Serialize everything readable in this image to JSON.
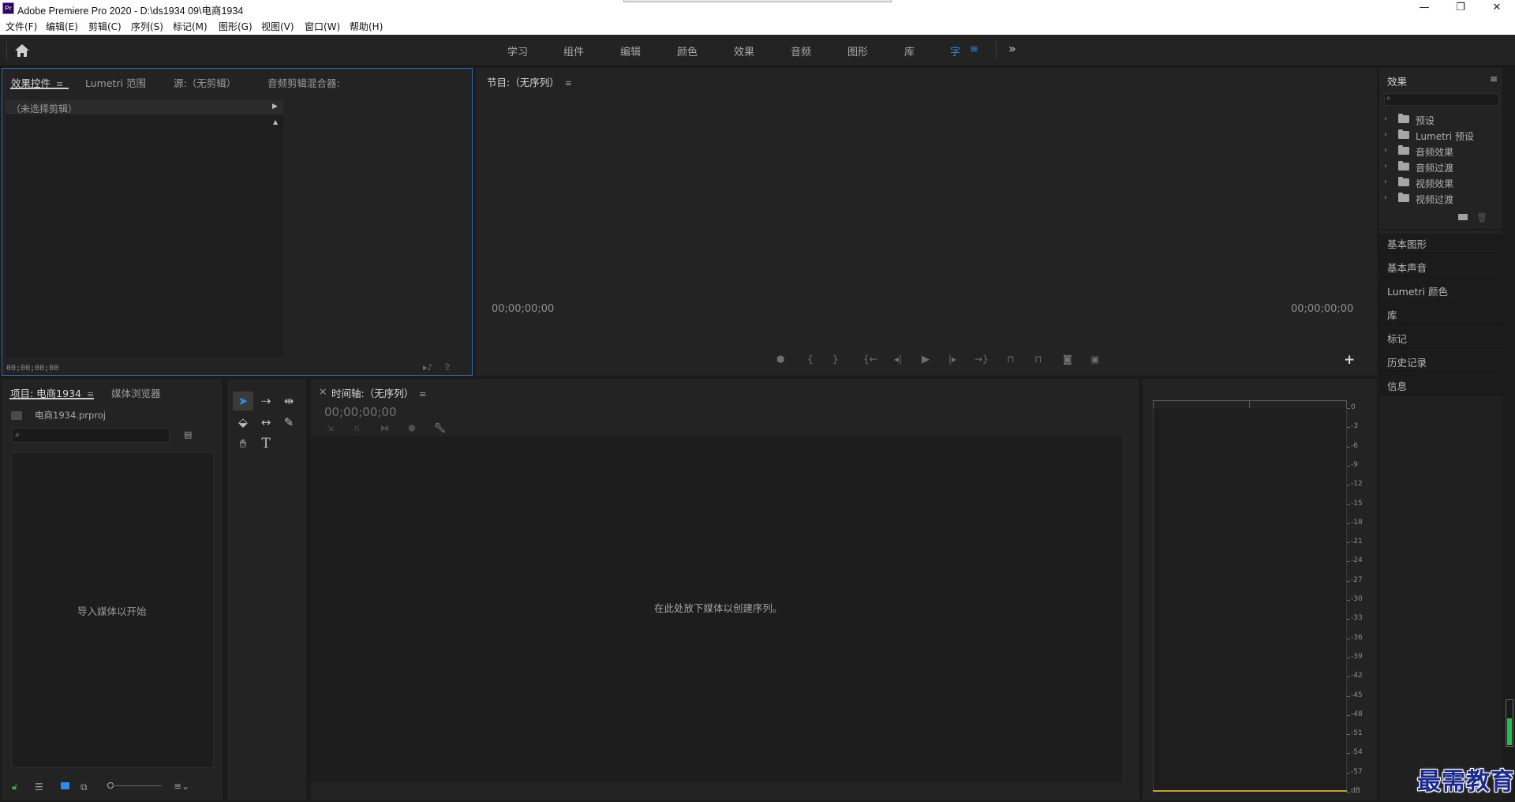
{
  "window": {
    "app_icon": "Pr",
    "title": "Adobe Premiere Pro 2020 - D:\\ds1934  09\\电商1934",
    "controls": {
      "minimize": "—",
      "restore": "❐",
      "close": "✕"
    }
  },
  "menu": {
    "items": [
      "文件(F)",
      "编辑(E)",
      "剪辑(C)",
      "序列(S)",
      "标记(M)",
      "图形(G)",
      "视图(V)",
      "窗口(W)",
      "帮助(H)"
    ]
  },
  "workspaces": {
    "tabs": [
      "学习",
      "组件",
      "编辑",
      "颜色",
      "效果",
      "音频",
      "图形",
      "库",
      "字"
    ],
    "active": "字",
    "menu_icon": "≡",
    "overflow": "»"
  },
  "source_panel": {
    "tabs": [
      "效果控件",
      "Lumetri 范围",
      "源:（无剪辑）",
      "音频剪辑混合器:"
    ],
    "menu_icon": "≡",
    "no_clip": "（未选择剪辑）",
    "timecode": "00;00;00;00"
  },
  "program_panel": {
    "title": "节目:（无序列）",
    "menu_icon": "≡",
    "timecode_left": "00;00;00;00",
    "timecode_right": "00;00;00;00",
    "add_button": "+"
  },
  "project_panel": {
    "tabs": [
      "项目: 电商1934",
      "媒体浏览器"
    ],
    "menu_icon": "≡",
    "file_name": "电商1934.prproj",
    "search_placeholder": "",
    "empty_text": "导入媒体以开始"
  },
  "timeline_panel": {
    "close": "×",
    "title": "时间轴:（无序列）",
    "menu_icon": "≡",
    "timecode": "00;00;00;00",
    "drop_text": "在此处放下媒体以创建序列。"
  },
  "audio_meter": {
    "ticks": [
      "0",
      "-3",
      "-6",
      "-9",
      "-12",
      "-15",
      "-18",
      "-21",
      "-24",
      "-27",
      "-30",
      "-33",
      "-36",
      "-39",
      "-42",
      "-45",
      "-48",
      "-51",
      "-54",
      "-57",
      "dB"
    ]
  },
  "effects_panel": {
    "title": "效果",
    "menu_icon": "≡",
    "items": [
      "预设",
      "Lumetri 预设",
      "音频效果",
      "音频过渡",
      "视频效果",
      "视频过渡"
    ]
  },
  "side_panels": [
    "基本图形",
    "基本声音",
    "Lumetri 颜色",
    "库",
    "标记",
    "历史记录",
    "信息"
  ],
  "watermark": "最需教育",
  "colors": {
    "accent": "#2d8ceb",
    "panel_bg": "#232323",
    "frame_bg": "#1b1b1b",
    "active_border": "#2d6db5"
  }
}
